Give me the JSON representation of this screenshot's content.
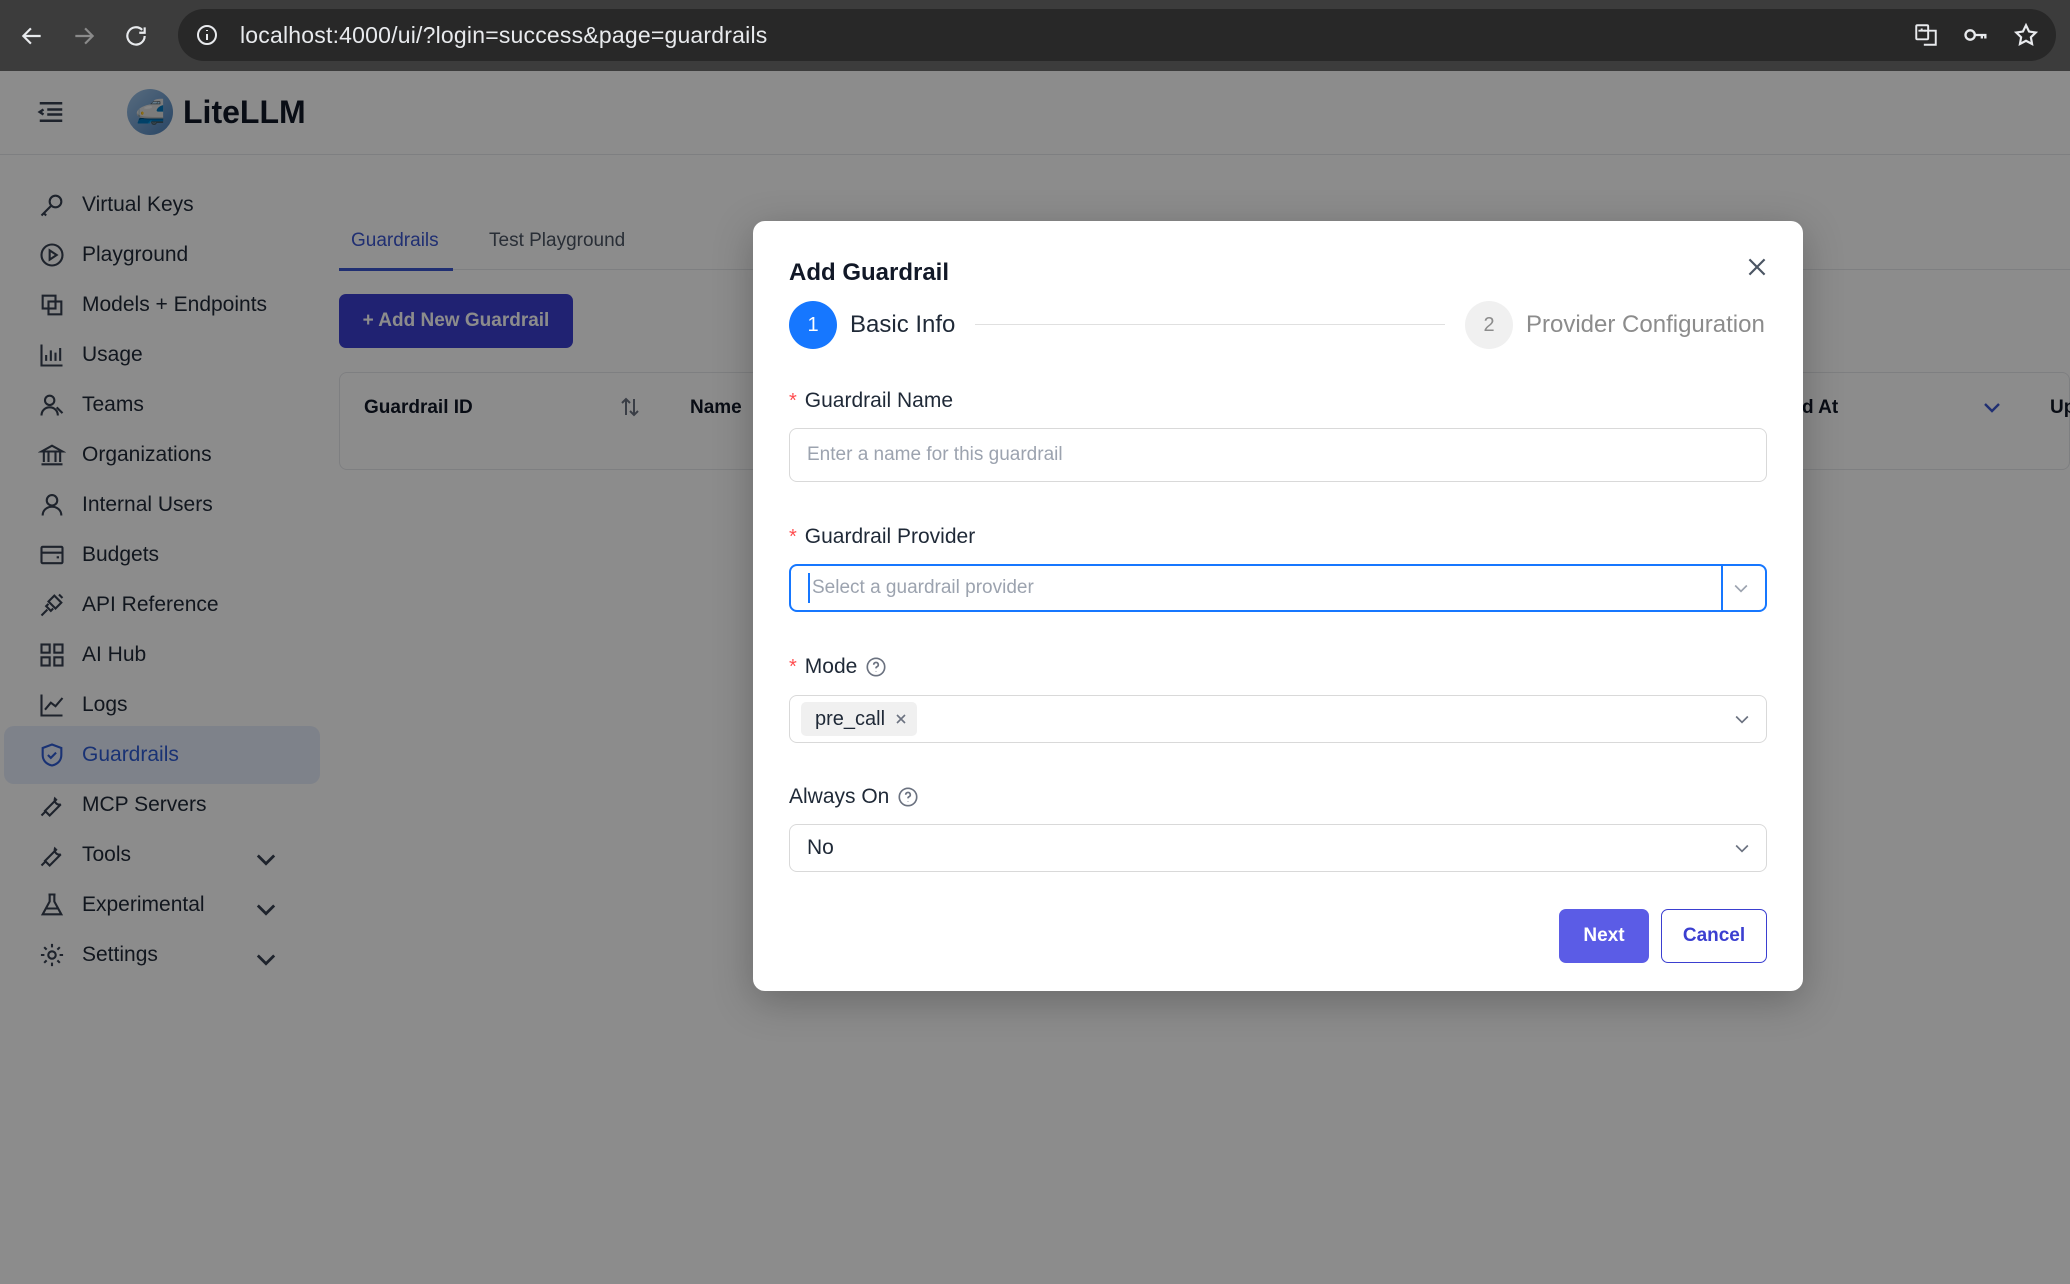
{
  "browser": {
    "url": "localhost:4000/ui/?login=success&page=guardrails"
  },
  "app": {
    "name": "LiteLLM"
  },
  "sidebar": {
    "items": [
      {
        "label": "Virtual Keys",
        "icon": "key-icon"
      },
      {
        "label": "Playground",
        "icon": "play-icon"
      },
      {
        "label": "Models + Endpoints",
        "icon": "models-icon"
      },
      {
        "label": "Usage",
        "icon": "bar-chart-icon"
      },
      {
        "label": "Teams",
        "icon": "team-icon"
      },
      {
        "label": "Organizations",
        "icon": "bank-icon"
      },
      {
        "label": "Internal Users",
        "icon": "user-icon"
      },
      {
        "label": "Budgets",
        "icon": "wallet-icon"
      },
      {
        "label": "API Reference",
        "icon": "api-icon"
      },
      {
        "label": "AI Hub",
        "icon": "grid-icon"
      },
      {
        "label": "Logs",
        "icon": "line-chart-icon"
      },
      {
        "label": "Guardrails",
        "icon": "shield-icon",
        "active": true
      },
      {
        "label": "MCP Servers",
        "icon": "tool-icon"
      },
      {
        "label": "Tools",
        "icon": "tool-icon",
        "expandable": true
      },
      {
        "label": "Experimental",
        "icon": "flask-icon",
        "expandable": true
      },
      {
        "label": "Settings",
        "icon": "gear-icon",
        "expandable": true
      }
    ]
  },
  "main": {
    "tabs": [
      {
        "label": "Guardrails",
        "active": true
      },
      {
        "label": "Test Playground",
        "active": false
      }
    ],
    "add_button": "+ Add New Guardrail",
    "table_headers": {
      "guardrail_id": "Guardrail ID",
      "name": "Name",
      "created_at_partial": "d At",
      "updated_partial": "Up"
    }
  },
  "modal": {
    "title": "Add Guardrail",
    "steps": [
      {
        "number": "1",
        "label": "Basic Info",
        "state": "current"
      },
      {
        "number": "2",
        "label": "Provider Configuration",
        "state": "pending"
      }
    ],
    "fields": {
      "name": {
        "label": "Guardrail Name",
        "placeholder": "Enter a name for this guardrail",
        "required": true
      },
      "provider": {
        "label": "Guardrail Provider",
        "placeholder": "Select a guardrail provider",
        "required": true
      },
      "mode": {
        "label": "Mode",
        "value_tag": "pre_call",
        "required": true
      },
      "always_on": {
        "label": "Always On",
        "value": "No",
        "required": false
      }
    },
    "buttons": {
      "next": "Next",
      "cancel": "Cancel"
    }
  },
  "colors": {
    "primary": "#1677ff",
    "accent_button": "#5b5ce6",
    "sidebar_active_bg": "#e6edfb",
    "required": "#ff4d4f"
  }
}
